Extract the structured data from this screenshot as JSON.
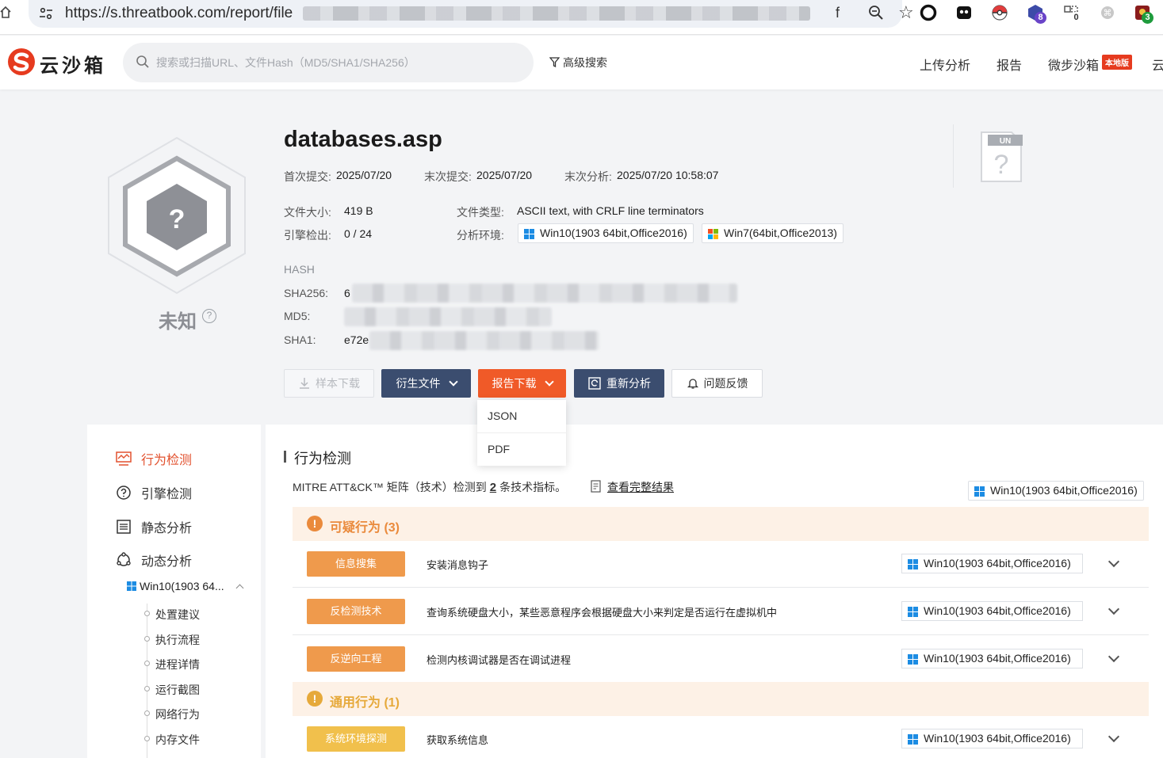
{
  "browser": {
    "url_prefix": "https://s.threatbook.com/report/file",
    "url_suffix": "f",
    "extension_badges": [
      "8",
      "0",
      "3"
    ]
  },
  "header": {
    "logo_text": "云沙箱",
    "search_placeholder": "搜索或扫描URL、文件Hash（MD5/SHA1/SHA256）",
    "advanced_search": "高级搜索",
    "nav": [
      "上传分析",
      "报告",
      "微步沙箱",
      "云"
    ],
    "local_badge": "本地版"
  },
  "file": {
    "name": "databases.asp",
    "verdict": "未知",
    "first_submit_label": "首次提交:",
    "first_submit": "2025/07/20",
    "last_submit_label": "末次提交:",
    "last_submit": "2025/07/20",
    "last_analysis_label": "末次分析:",
    "last_analysis": "2025/07/20 10:58:07",
    "size_label": "文件大小:",
    "size": "419 B",
    "engine_label": "引擎检出:",
    "engine": "0 / 24",
    "type_label": "文件类型:",
    "type": "ASCII text, with CRLF line terminators",
    "env_label": "分析环境:",
    "envs": [
      "Win10(1903 64bit,Office2016)",
      "Win7(64bit,Office2013)"
    ],
    "hash_title": "HASH",
    "sha256_label": "SHA256:",
    "sha256_visible": "6",
    "md5_label": "MD5:",
    "sha1_label": "SHA1:",
    "sha1_visible": "e72e",
    "un_label": "UN"
  },
  "actions": {
    "sample_download": "样本下载",
    "derived_files": "衍生文件",
    "report_download": "报告下载",
    "reanalyze": "重新分析",
    "feedback": "问题反馈",
    "dropdown": [
      "JSON",
      "PDF"
    ]
  },
  "sidebar": {
    "items": [
      "行为检测",
      "引擎检测",
      "静态分析",
      "动态分析"
    ],
    "sub_env": "Win10(1903 64...",
    "tree": [
      "处置建议",
      "执行流程",
      "进程详情",
      "运行截图",
      "网络行为",
      "内存文件"
    ]
  },
  "behavior": {
    "title": "行为检测",
    "mitre_prefix": "MITRE ATT&CK™ 矩阵（技术）检测到",
    "mitre_count": "2",
    "mitre_suffix": "条技术指标。",
    "view_full": "查看完整结果",
    "env": "Win10(1903 64bit,Office2016)",
    "categories": [
      {
        "label": "可疑行为 (3)",
        "color": "#ea8a3c"
      },
      {
        "label": "通用行为 (1)",
        "color": "#e6a93a"
      }
    ],
    "rows": [
      {
        "tag": "信息搜集",
        "desc": "安装消息钩子",
        "env": "Win10(1903 64bit,Office2016)",
        "color": "#ef9a4c"
      },
      {
        "tag": "反检测技术",
        "desc": "查询系统硬盘大小，某些恶意程序会根据硬盘大小来判定是否运行在虚拟机中",
        "env": "Win10(1903 64bit,Office2016)",
        "color": "#ef9a4c"
      },
      {
        "tag": "反逆向工程",
        "desc": "检测内核调试器是否在调试进程",
        "env": "Win10(1903 64bit,Office2016)",
        "color": "#ef9a4c"
      },
      {
        "tag": "系统环境探测",
        "desc": "获取系统信息",
        "env": "Win10(1903 64bit,Office2016)",
        "color": "#f1c04c"
      }
    ]
  }
}
